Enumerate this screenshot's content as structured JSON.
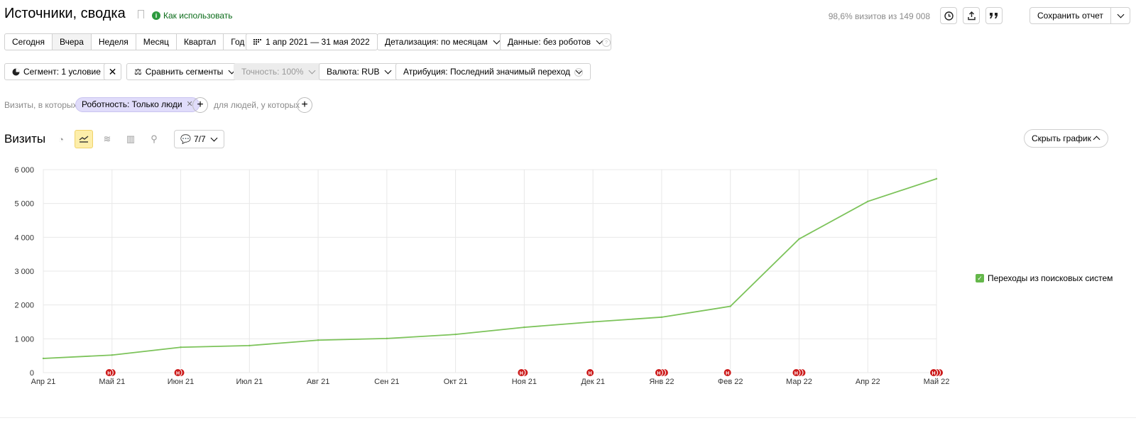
{
  "header": {
    "title": "Источники, сводка",
    "howto_label": "Как использовать",
    "visits_share": "98,6% визитов из 149 008",
    "save_label": "Сохранить отчет"
  },
  "periods": [
    "Сегодня",
    "Вчера",
    "Неделя",
    "Месяц",
    "Квартал",
    "Год"
  ],
  "date_range": "1 апр 2021 — 31 мая 2022",
  "detail_label": "Детализация: по месяцам",
  "data_label": "Данные: без роботов",
  "segment_label": "Сегмент: 1 условие",
  "compare_label": "Сравнить сегменты",
  "precision_label": "Точность: 100%",
  "currency_label": "Валюта: RUB",
  "attribution_label": "Атрибуция: Последний значимый переход",
  "conditions": {
    "visits_text": "Визиты, в которых",
    "chip_label": "Роботность: Только люди",
    "people_text": "для людей, у которых"
  },
  "section": {
    "title": "Визиты",
    "comments_label": "7/7",
    "hide_chart_label": "Скрыть график"
  },
  "chart_data": {
    "type": "line",
    "x": [
      "Апр 21",
      "Май 21",
      "Июн 21",
      "Июл 21",
      "Авг 21",
      "Сен 21",
      "Окт 21",
      "Ноя 21",
      "Дек 21",
      "Янв 22",
      "Фев 22",
      "Мар 22",
      "Апр 22",
      "Май 22"
    ],
    "series": [
      {
        "name": "Переходы из поисковых систем",
        "values": [
          420,
          520,
          750,
          800,
          960,
          1010,
          1130,
          1340,
          1500,
          1640,
          1960,
          3950,
          5060,
          5730
        ],
        "color": "#7cc35a"
      }
    ],
    "ylim": [
      0,
      6000
    ],
    "yticks": [
      0,
      1000,
      2000,
      3000,
      4000,
      5000,
      6000
    ],
    "ytick_labels": [
      "0",
      "1 000",
      "2 000",
      "3 000",
      "4 000",
      "5 000",
      "6 000"
    ],
    "grid": true,
    "legend_position": "right",
    "annotation_markers": [
      {
        "x": "Май 21",
        "count": 2
      },
      {
        "x": "Июн 21",
        "count": 2
      },
      {
        "x": "Ноя 21",
        "count": 2
      },
      {
        "x": "Дек 21",
        "count": 1
      },
      {
        "x": "Янв 22",
        "count": 3
      },
      {
        "x": "Фев 22",
        "count": 1
      },
      {
        "x": "Мар 22",
        "count": 3
      },
      {
        "x": "Май 22",
        "count": 3
      }
    ],
    "annotation_color": "#cc1b1b"
  }
}
